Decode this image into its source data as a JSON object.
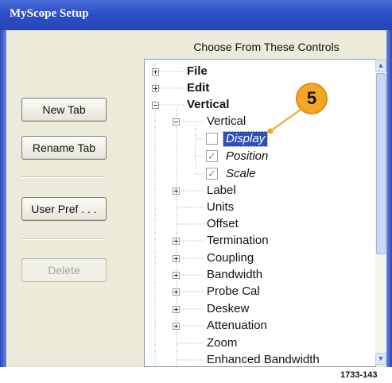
{
  "window": {
    "title": "MyScope Setup"
  },
  "caption": "Choose From These Controls",
  "buttons": {
    "new_tab": "New Tab",
    "rename_tab": "Rename Tab",
    "user_pref": "User Pref . . .",
    "delete": "Delete"
  },
  "tree": {
    "file": "File",
    "edit": "Edit",
    "vertical": "Vertical",
    "vertical_child": "Vertical",
    "display": "Display",
    "position": "Position",
    "scale": "Scale",
    "label": "Label",
    "units": "Units",
    "offset": "Offset",
    "termination": "Termination",
    "coupling": "Coupling",
    "bandwidth": "Bandwidth",
    "probe_cal": "Probe Cal",
    "deskew": "Deskew",
    "attenuation": "Attenuation",
    "zoom": "Zoom",
    "enhanced_bandwidth": "Enhanced Bandwidth"
  },
  "callout": {
    "number": "5",
    "color": "#f5a623"
  },
  "figure_code": "1733-143"
}
